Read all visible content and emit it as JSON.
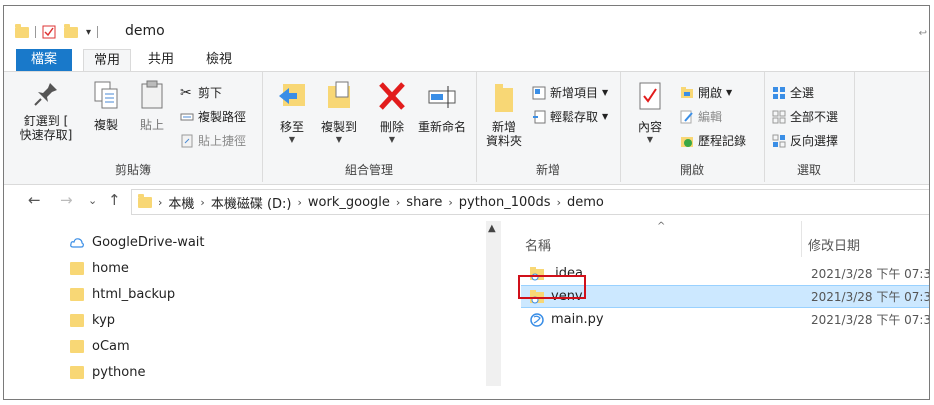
{
  "window": {
    "title": "demo"
  },
  "ribbon_tabs": [
    {
      "label": "檔案"
    },
    {
      "label": "常用"
    },
    {
      "label": "共用"
    },
    {
      "label": "檢視"
    }
  ],
  "ribbon": {
    "clipboard": {
      "pin": "釘選到 [\n快速存取]",
      "copy": "複製",
      "paste": "貼上",
      "cut": "剪下",
      "copy_path": "複製路徑",
      "paste_shortcut": "貼上捷徑",
      "label": "剪貼簿"
    },
    "organize": {
      "move_to": "移至",
      "copy_to": "複製到",
      "delete": "刪除",
      "rename": "重新命名",
      "label": "組合管理"
    },
    "new": {
      "new_folder": "新增\n資料夾",
      "new_item": "新增項目",
      "easy_access": "輕鬆存取",
      "label": "新增"
    },
    "open": {
      "properties": "內容",
      "open": "開啟",
      "edit": "編輯",
      "history": "歷程記錄",
      "label": "開啟"
    },
    "select": {
      "select_all": "全選",
      "select_none": "全部不選",
      "invert": "反向選擇",
      "label": "選取"
    }
  },
  "address": {
    "crumbs": [
      "本機",
      "本機磁碟 (D:)",
      "work_google",
      "share",
      "python_100ds",
      "demo"
    ]
  },
  "nav_pane": {
    "items": [
      {
        "label": "GoogleDrive-wait",
        "icon": "cloud-icon"
      },
      {
        "label": "home",
        "icon": "folder-icon"
      },
      {
        "label": "html_backup",
        "icon": "folder-icon"
      },
      {
        "label": "kyp",
        "icon": "folder-icon"
      },
      {
        "label": "oCam",
        "icon": "folder-icon"
      },
      {
        "label": "pythone",
        "icon": "folder-icon"
      }
    ]
  },
  "file_list": {
    "columns": {
      "name": "名稱",
      "date": "修改日期"
    },
    "rows": [
      {
        "name": ".idea",
        "date": "2021/3/28 下午 07:3",
        "icon": "synced-folder-icon"
      },
      {
        "name": "venv",
        "date": "2021/3/28 下午 07:3",
        "icon": "synced-folder-icon"
      },
      {
        "name": "main.py",
        "date": "2021/3/28 下午 07:3",
        "icon": "python-file-icon"
      }
    ],
    "selected_row": "venv"
  },
  "colors": {
    "accent": "#1979ca",
    "selection": "#cce8ff",
    "highlight_box": "#d0101a",
    "folder": "#f8d775"
  }
}
